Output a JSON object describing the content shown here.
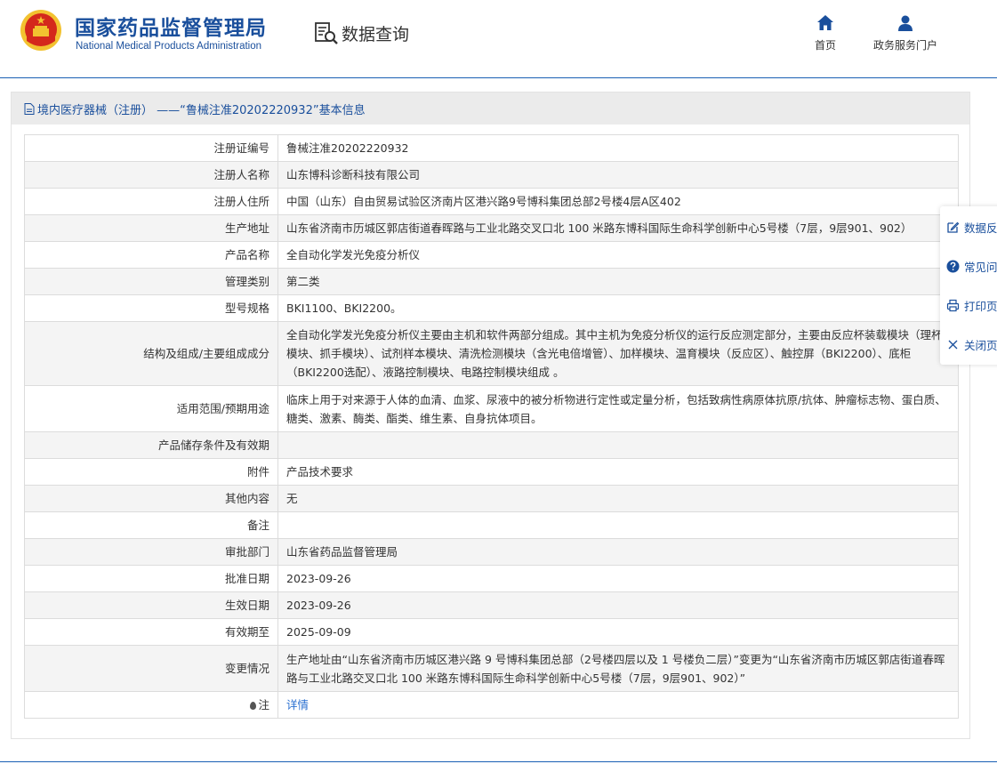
{
  "header": {
    "brand_cn": "国家药品监督管理局",
    "brand_en": "National Medical Products Administration",
    "query_label": "数据查询",
    "nav": {
      "home": "首页",
      "portal": "政务服务门户"
    }
  },
  "panel": {
    "title": "境内医疗器械（注册） ——“鲁械注准20202220932”基本信息"
  },
  "rows": [
    {
      "label": "注册证编号",
      "value": "鲁械注准20202220932"
    },
    {
      "label": "注册人名称",
      "value": "山东博科诊断科技有限公司"
    },
    {
      "label": "注册人住所",
      "value": "中国（山东）自由贸易试验区济南片区港兴路9号博科集团总部2号楼4层A区402"
    },
    {
      "label": "生产地址",
      "value": "山东省济南市历城区郭店街道春晖路与工业北路交叉口北 100 米路东博科国际生命科学创新中心5号楼（7层，9层901、902）"
    },
    {
      "label": "产品名称",
      "value": "全自动化学发光免疫分析仪"
    },
    {
      "label": "管理类别",
      "value": "第二类"
    },
    {
      "label": "型号规格",
      "value": "BKI1100、BKI2200。"
    },
    {
      "label": "结构及组成/主要组成成分",
      "value": "全自动化学发光免疫分析仪主要由主机和软件两部分组成。其中主机为免疫分析仪的运行反应测定部分，主要由反应杯装载模块（理杯模块、抓手模块）、试剂样本模块、清洗检测模块（含光电倍增管）、加样模块、温育模块（反应区）、触控屏（BKI2200）、底柜（BKI2200选配）、液路控制模块、电路控制模块组成 。"
    },
    {
      "label": "适用范围/预期用途",
      "value": "临床上用于对来源于人体的血清、血浆、尿液中的被分析物进行定性或定量分析，包括致病性病原体抗原/抗体、肿瘤标志物、蛋白质、糖类、激素、酶类、酯类、维生素、自身抗体项目。"
    },
    {
      "label": "产品储存条件及有效期",
      "value": ""
    },
    {
      "label": "附件",
      "value": "产品技术要求"
    },
    {
      "label": "其他内容",
      "value": "无"
    },
    {
      "label": "备注",
      "value": ""
    },
    {
      "label": "审批部门",
      "value": "山东省药品监督管理局"
    },
    {
      "label": "批准日期",
      "value": "2023-09-26"
    },
    {
      "label": "生效日期",
      "value": "2023-09-26"
    },
    {
      "label": "有效期至",
      "value": "2025-09-09"
    },
    {
      "label": "变更情况",
      "value": "生产地址由“山东省济南市历城区港兴路 9 号博科集团总部（2号楼四层以及 1 号楼负二层）”变更为“山东省济南市历城区郭店街道春晖路与工业北路交叉口北 100 米路东博科国际生命科学创新中心5号楼（7层，9层901、902）”"
    }
  ],
  "note_row": {
    "label": "注",
    "link": "详情"
  },
  "side_menu": {
    "feedback": "数据反",
    "faq": "常见问",
    "print": "打印页",
    "close": "关闭页"
  },
  "colors": {
    "brand_blue": "#1a4f9c",
    "link_blue": "#2a6fd1",
    "emblem_red": "#d4281c",
    "emblem_gold": "#f2c230"
  }
}
